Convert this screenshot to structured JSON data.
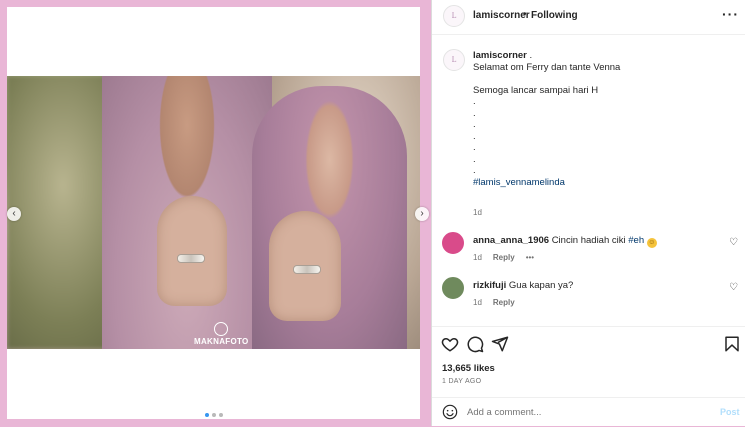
{
  "post": {
    "watermark_text": "MAKNAFOTO",
    "nav_prev_icon": "chevron-left-icon",
    "nav_next_icon": "chevron-right-icon"
  },
  "header": {
    "username": "lamiscorner",
    "separator": "•",
    "follow_status": "Following",
    "more_icon": "more-options-icon"
  },
  "caption": {
    "username": "lamiscorner",
    "lines": "Selamat om Ferry dan tante Venna\n\nSemoga lancar sampai hari H\n.\n.\n.\n.\n.\n.\n.",
    "hashtag": "#lamis_vennamelinda",
    "time": "1d"
  },
  "comments": [
    {
      "username": "anna_anna_1906",
      "text": "Cincin hadiah ciki",
      "hashtag": "#eh",
      "time": "1d",
      "reply_label": "Reply",
      "more": "•••"
    },
    {
      "username": "rizkifuji",
      "text": "Gua kapan ya?",
      "time": "1d",
      "reply_label": "Reply"
    }
  ],
  "actions": {
    "likes": "13,665 likes",
    "date": "1 DAY AGO"
  },
  "add_comment": {
    "placeholder": "Add a comment...",
    "post_label": "Post"
  },
  "colors": {
    "frame": "#e9b6d6",
    "link": "#00376b",
    "post_disabled": "#b2dffc"
  }
}
